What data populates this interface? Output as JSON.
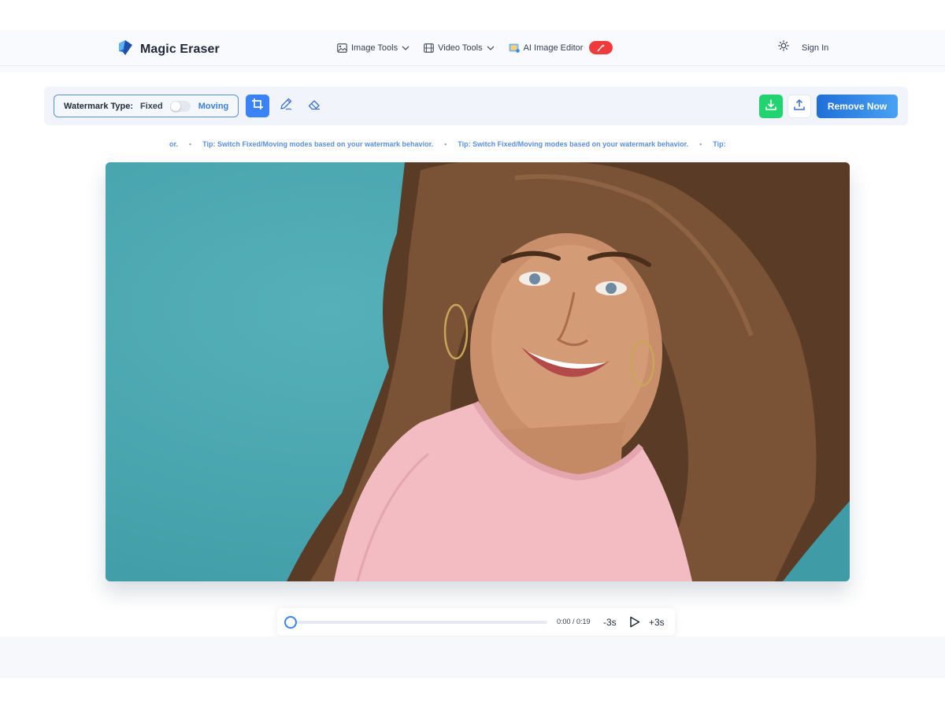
{
  "app": {
    "title": "Magic Eraser"
  },
  "nav": {
    "image_tools": "Image Tools",
    "video_tools": "Video Tools",
    "ai_image_editor": "AI Image Editor",
    "sign_in": "Sign In"
  },
  "toolbar": {
    "watermark_label": "Watermark Type:",
    "fixed": "Fixed",
    "moving": "Moving",
    "remove_label": "Remove Now"
  },
  "ticker": {
    "lead": "or.",
    "tip": "Tip: Switch Fixed/Moving modes based on your watermark behavior.",
    "tail": "Tip:",
    "dot": "•"
  },
  "player": {
    "time": "0:00 / 0:19",
    "back": "-3s",
    "forward": "+3s",
    "progress": 0
  },
  "colors": {
    "accent": "#3b82f6",
    "download": "#22d46f",
    "badge": "#ef3b3b",
    "image_background": "#4aa6b0"
  },
  "icons": [
    "logo-icon",
    "image-icon",
    "chevron-down-icon",
    "film-icon",
    "ai-editor-icon",
    "magic-wand-icon",
    "sun-icon",
    "crop-icon",
    "pen-icon",
    "eraser-icon",
    "download-icon",
    "upload-icon",
    "play-icon"
  ]
}
